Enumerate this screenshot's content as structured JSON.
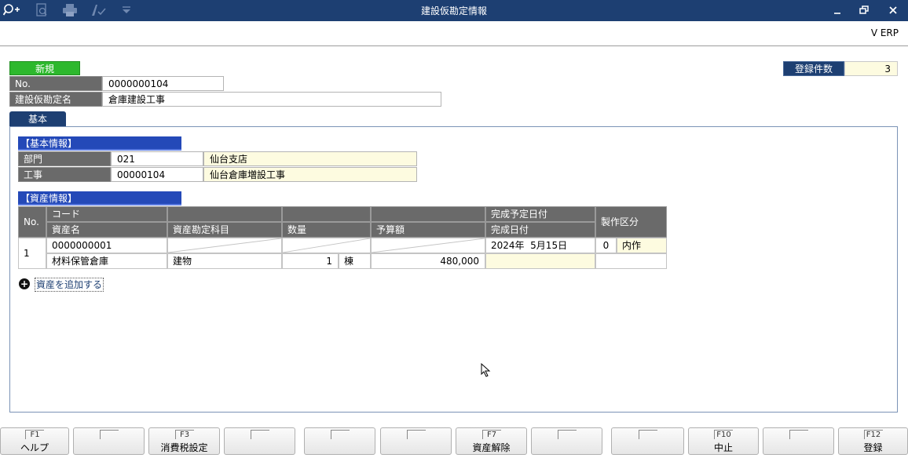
{
  "window": {
    "title": "建設仮勘定情報",
    "brand": "V ERP",
    "controls": [
      "minimize-icon",
      "restore-icon",
      "close-icon"
    ],
    "toolbar_icons": [
      "zoom-in-icon",
      "preview-icon",
      "print-icon",
      "approve-icon",
      "dropdown-icon"
    ]
  },
  "header": {
    "mode_badge": "新規",
    "no_label": "No.",
    "no_value": "0000000104",
    "name_label": "建設仮勘定名",
    "name_value": "倉庫建設工事",
    "count_label": "登録件数",
    "count_value": "3"
  },
  "tabs": [
    {
      "label": "基本",
      "active": true
    }
  ],
  "basic_info": {
    "section_title": "【基本情報】",
    "rows": [
      {
        "label": "部門",
        "code": "021",
        "name": "仙台支店"
      },
      {
        "label": "工事",
        "code": "00000104",
        "name": "仙台倉庫増設工事"
      }
    ]
  },
  "asset_info": {
    "section_title": "【資産情報】",
    "headers": {
      "no": "No.",
      "code": "コード",
      "asset_name": "資産名",
      "account": "資産勘定科目",
      "quantity": "数量",
      "budget": "予算額",
      "planned_date": "完成予定日付",
      "completion_date": "完成日付",
      "production_type": "製作区分"
    },
    "rows": [
      {
        "no": "1",
        "code": "0000000001",
        "asset_name": "材料保管倉庫",
        "account": "建物",
        "quantity": "1",
        "unit": "棟",
        "budget": "480,000",
        "planned_date": "2024年  5月15日",
        "completion_date": "",
        "production_code": "0",
        "production_name": "内作"
      }
    ],
    "add_link": "資産を追加する"
  },
  "function_keys": [
    {
      "code": "F1",
      "label": "ヘルプ"
    },
    {
      "code": "",
      "label": ""
    },
    {
      "code": "F3",
      "label": "消費税設定"
    },
    {
      "code": "",
      "label": ""
    },
    {
      "code": "",
      "label": ""
    },
    {
      "code": "",
      "label": ""
    },
    {
      "code": "F7",
      "label": "資産解除"
    },
    {
      "code": "",
      "label": ""
    },
    {
      "code": "",
      "label": ""
    },
    {
      "code": "F10",
      "label": "中止"
    },
    {
      "code": "",
      "label": ""
    },
    {
      "code": "F12",
      "label": "登録"
    }
  ],
  "colors": {
    "titlebar": "#1d3f72",
    "new_badge": "#2db82d",
    "section_header": "#2449b8",
    "grid_header": "#6a6a6a",
    "readonly_bg": "#fdfbe0"
  }
}
